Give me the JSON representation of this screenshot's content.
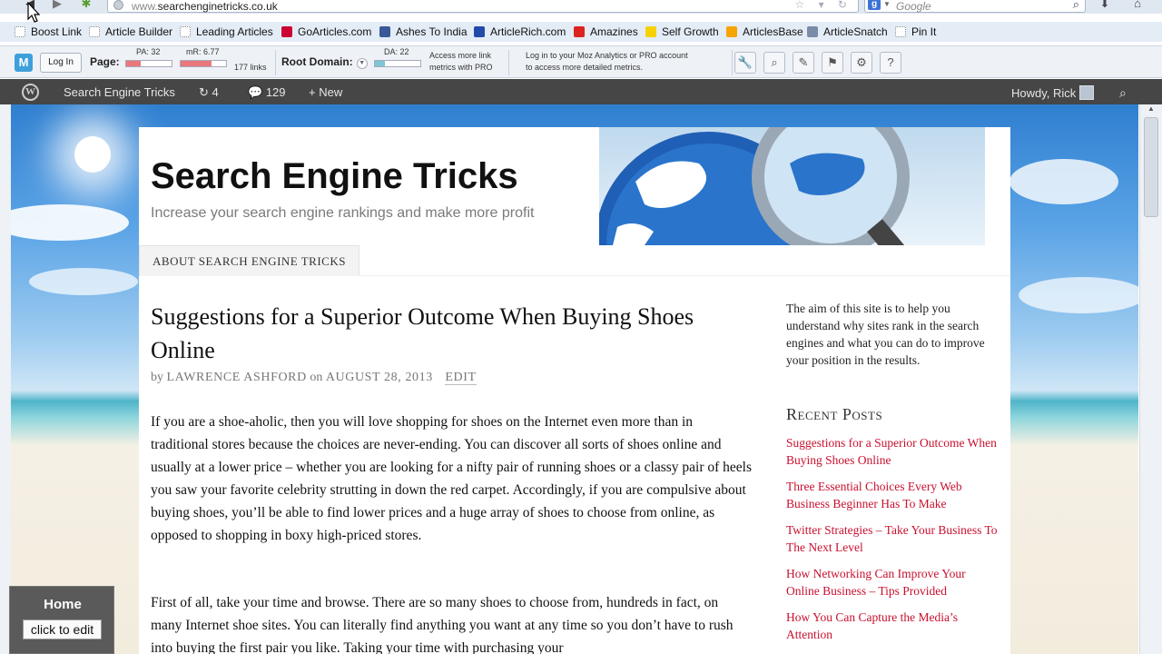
{
  "browser": {
    "url_host": "www.",
    "url_rest": "searchenginetricks.co.uk",
    "search_placeholder": "Google",
    "search_engine_glyph": "g"
  },
  "bookmarks": [
    {
      "label": "Boost Link",
      "icon": "page-icon"
    },
    {
      "label": "Article Builder",
      "icon": "page-icon"
    },
    {
      "label": "Leading Articles",
      "icon": "page-icon"
    },
    {
      "label": "GoArticles.com",
      "icon": "goarticles-icon"
    },
    {
      "label": "Ashes To India",
      "icon": "facebook-icon"
    },
    {
      "label": "ArticleRich.com",
      "icon": "articlerich-icon"
    },
    {
      "label": "Amazines",
      "icon": "amazines-icon"
    },
    {
      "label": "Self Growth",
      "icon": "sun-icon"
    },
    {
      "label": "ArticlesBase",
      "icon": "articlesbase-icon"
    },
    {
      "label": "ArticleSnatch",
      "icon": "articlesnatch-icon"
    },
    {
      "label": "Pin It",
      "icon": "page-icon"
    }
  ],
  "mozbar": {
    "logo_glyph": "M",
    "login_label": "Log In",
    "page_label": "Page:",
    "pa_label": "PA: 32",
    "pa_value": 0.32,
    "mr_label": "mR: 6.77",
    "mr_value": 0.677,
    "links_label": "177 links",
    "root_domain_label": "Root Domain:",
    "da_label": "DA: 22",
    "da_value": 0.22,
    "access_note_1": "Access more link",
    "access_note_2": "metrics with PRO",
    "login_note_1": "Log in to your Moz Analytics or PRO account",
    "login_note_2": "to access more detailed metrics."
  },
  "wpbar": {
    "site_name": "Search Engine Tricks",
    "updates_count": "4",
    "comments_count": "129",
    "new_label": "New",
    "howdy": "Howdy, Rick"
  },
  "site": {
    "title": "Search Engine Tricks",
    "description": "Increase your search engine rankings and make more profit",
    "menu_item": "ABOUT SEARCH ENGINE TRICKS"
  },
  "post": {
    "title": "Suggestions for a Superior Outcome When Buying Shoes Online",
    "by": "by",
    "author": "LAWRENCE ASHFORD",
    "on": "on",
    "date": "AUGUST 28, 2013",
    "edit": "EDIT",
    "paragraph_1": "If you are a shoe-aholic, then you will love shopping for shoes on the Internet even more than in traditional stores because the choices are never-ending. You can discover all sorts of shoes online and usually at a lower price – whether you are looking for a nifty pair of running shoes or a classy pair of heels you saw your favorite celebrity strutting in down the red carpet. Accordingly, if you are compulsive about buying shoes, you’ll be able to find lower prices and a huge array of shoes to choose from online, as opposed to shopping in boxy high-priced stores.",
    "paragraph_2": "First of all, take your time and browse. There are so many shoes to choose from, hundreds in fact, on many Internet shoe sites. You can literally find anything you want at any time so you don’t have to rush into buying the first pair you like. Taking your time with purchasing your"
  },
  "sidebar": {
    "intro": "The aim of this site is to help you understand why sites rank in the search engines and what you can do to improve your position in the results.",
    "recent_heading": "Recent Posts",
    "recent_posts": [
      "Suggestions for a Superior Outcome When Buying Shoes Online",
      "Three Essential Choices Every Web Business Beginner Has To Make",
      "Twitter Strategies – Take Your Business To The Next Level",
      "How Networking Can Improve Your Online Business – Tips Provided",
      "How You Can Capture the Media’s Attention"
    ]
  },
  "home_widget": {
    "title": "Home",
    "edit_label": "click to edit"
  },
  "colors": {
    "link_red": "#c8102e",
    "wp_bar": "#464646",
    "moz_pa_bar": "#e8787c",
    "moz_da_bar": "#7cc6d6"
  }
}
